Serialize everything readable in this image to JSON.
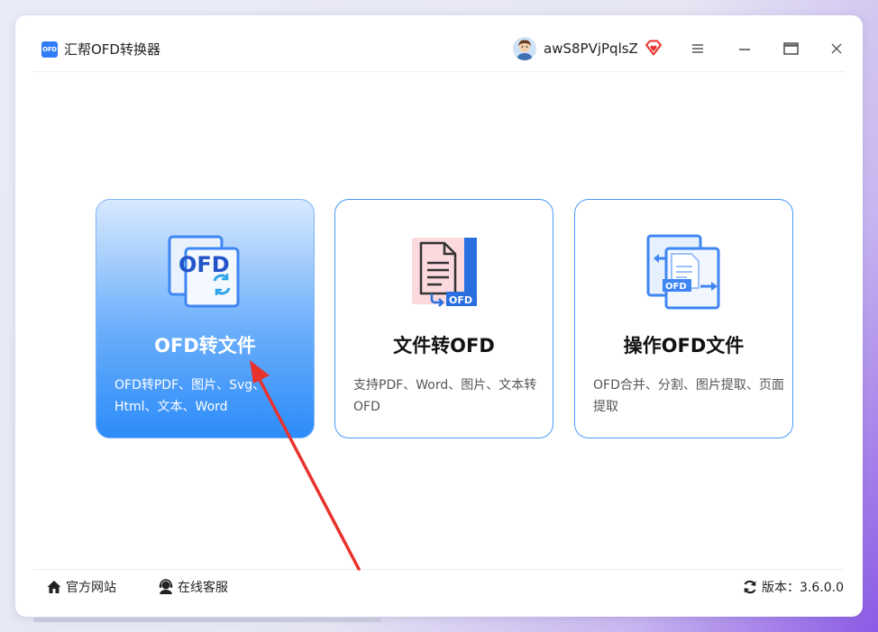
{
  "app": {
    "title": "汇帮OFD转换器",
    "logo_text": "OFD"
  },
  "user": {
    "name": "awS8PVjPqlsZ",
    "avatar_icon": "user-avatar-icon",
    "vip_icon": "diamond-heart-icon"
  },
  "window_controls": {
    "menu_icon": "hamburger-menu-icon",
    "minimize_icon": "minimize-icon",
    "maximize_icon": "maximize-icon",
    "close_icon": "close-icon"
  },
  "cards": [
    {
      "title": "OFD转文件",
      "description": "OFD转PDF、图片、Svg、Html、文本、Word",
      "icon": "ofd-convert-icon",
      "selected": true
    },
    {
      "title": "文件转OFD",
      "description": "支持PDF、Word、图片、文本转OFD",
      "icon": "document-to-ofd-icon",
      "selected": false
    },
    {
      "title": "操作OFD文件",
      "description": "OFD合并、分割、图片提取、页面提取",
      "icon": "ofd-operate-icon",
      "selected": false
    }
  ],
  "footer": {
    "website_label": "官方网站",
    "service_label": "在线客服",
    "version_label": "版本：3.6.0.0"
  },
  "colors": {
    "accent": "#2c8cf9",
    "card_border": "#4a9af7",
    "annotation_arrow": "#e8322c"
  }
}
